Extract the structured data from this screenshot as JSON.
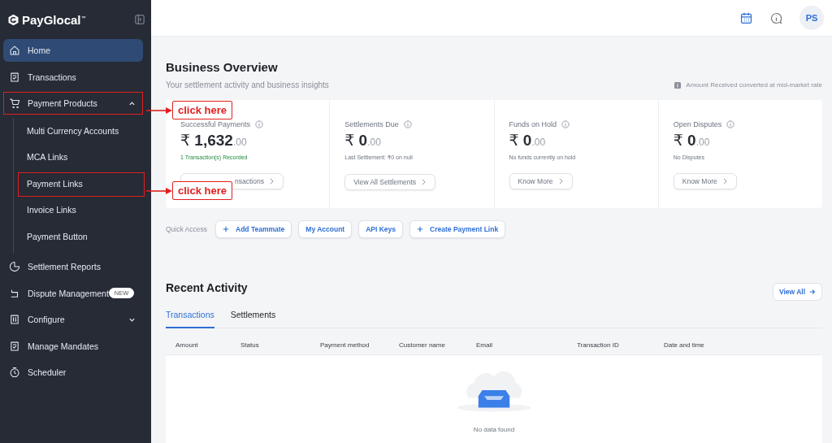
{
  "brand": {
    "name": "PayGlocal",
    "mark": "™"
  },
  "sidebar": {
    "items": [
      {
        "label": "Home",
        "selected": true,
        "highlighted": false
      },
      {
        "label": "Transactions",
        "selected": false,
        "highlighted": false
      },
      {
        "label": "Payment Products",
        "selected": false,
        "highlighted": true,
        "expanded": true,
        "children": [
          {
            "label": "Multi Currency Accounts",
            "highlighted": false
          },
          {
            "label": "MCA Links",
            "highlighted": false
          },
          {
            "label": "Payment Links",
            "highlighted": true
          },
          {
            "label": "Invoice Links",
            "highlighted": false
          },
          {
            "label": "Payment Button",
            "highlighted": false
          }
        ]
      },
      {
        "label": "Settlement Reports",
        "selected": false,
        "highlighted": false
      },
      {
        "label": "Dispute Management",
        "selected": false,
        "highlighted": false,
        "badge": "NEW"
      },
      {
        "label": "Configure",
        "selected": false,
        "highlighted": false,
        "expanded": false
      },
      {
        "label": "Manage Mandates",
        "selected": false,
        "highlighted": false
      },
      {
        "label": "Scheduler",
        "selected": false,
        "highlighted": false
      }
    ]
  },
  "topbar": {
    "avatar": "PS"
  },
  "overview": {
    "title": "Business Overview",
    "subtitle": "Your settlement activity and business insights",
    "rate_note": "Amount Received converted at mid-market rate",
    "cards": [
      {
        "title": "Successful Payments",
        "currency": "₹",
        "whole": "1,632",
        "fraction": ".00",
        "note": "1 Transaction(s) Recorded",
        "positive": true,
        "button": "nsactions"
      },
      {
        "title": "Settlements Due",
        "currency": "₹",
        "whole": "0",
        "fraction": ".00",
        "note": "Last Settlement: ₹0 on null",
        "positive": false,
        "button": "View All Settlements"
      },
      {
        "title": "Funds on Hold",
        "currency": "₹",
        "whole": "0",
        "fraction": ".00",
        "note": "No funds currently on hold",
        "positive": false,
        "button": "Know More"
      },
      {
        "title": "Open Disputes",
        "currency": "₹",
        "whole": "0",
        "fraction": ".00",
        "note": "No Disputes",
        "positive": false,
        "button": "Know More"
      }
    ]
  },
  "quick_access": {
    "label": "Quick Access",
    "buttons": [
      {
        "label": "Add Teammate",
        "plus": true
      },
      {
        "label": "My Account",
        "plus": false
      },
      {
        "label": "API Keys",
        "plus": false
      },
      {
        "label": "Create Payment Link",
        "plus": true
      }
    ]
  },
  "recent": {
    "title": "Recent Activity",
    "view_all": "View All",
    "tabs": [
      {
        "label": "Transactions",
        "selected": true
      },
      {
        "label": "Settlements",
        "selected": false
      }
    ],
    "columns": [
      "Amount",
      "Status",
      "Payment method",
      "Customer name",
      "Email",
      "Transaction ID",
      "Date and time"
    ],
    "empty": "No data found"
  },
  "callouts": [
    {
      "text": "click here"
    },
    {
      "text": "click here"
    }
  ]
}
